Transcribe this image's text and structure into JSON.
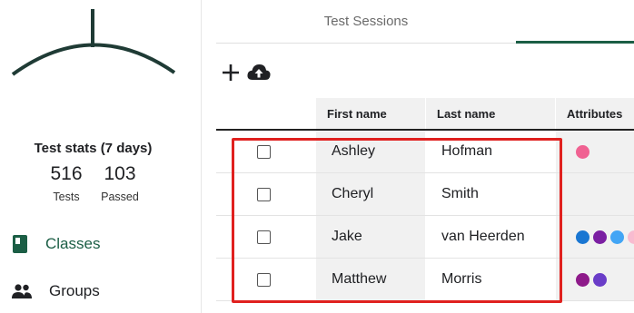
{
  "sidebar": {
    "logo_icon": "hanger-arc-logo",
    "stats": {
      "title": "Test stats (7 days)",
      "tests_value": "516",
      "tests_label": "Tests",
      "passed_value": "103",
      "passed_label": "Passed"
    },
    "nav": [
      {
        "label": "Classes",
        "icon": "book-icon",
        "active": true
      },
      {
        "label": "Groups",
        "icon": "people-icon",
        "active": false
      }
    ]
  },
  "main": {
    "tabs": [
      {
        "label": "Test Sessions"
      }
    ],
    "toolbar": {
      "add_icon": "plus-icon",
      "upload_icon": "cloud-upload-icon"
    },
    "table": {
      "headers": {
        "first": "First name",
        "last": "Last name",
        "attributes": "Attributes"
      },
      "rows": [
        {
          "first": "Ashley",
          "last": "Hofman",
          "attributes": [
            "#f06292"
          ]
        },
        {
          "first": "Cheryl",
          "last": "Smith",
          "attributes": []
        },
        {
          "first": "Jake",
          "last": "van Heerden",
          "attributes": [
            "#1976d2",
            "#7b1fa2",
            "#42a5f5",
            "#f8bbd0"
          ]
        },
        {
          "first": "Matthew",
          "last": "Morris",
          "attributes": [
            "#8e1a8a",
            "#6a3dc8"
          ]
        }
      ]
    }
  },
  "colors": {
    "accent": "#1b5e45",
    "highlight": "#e0211f"
  }
}
